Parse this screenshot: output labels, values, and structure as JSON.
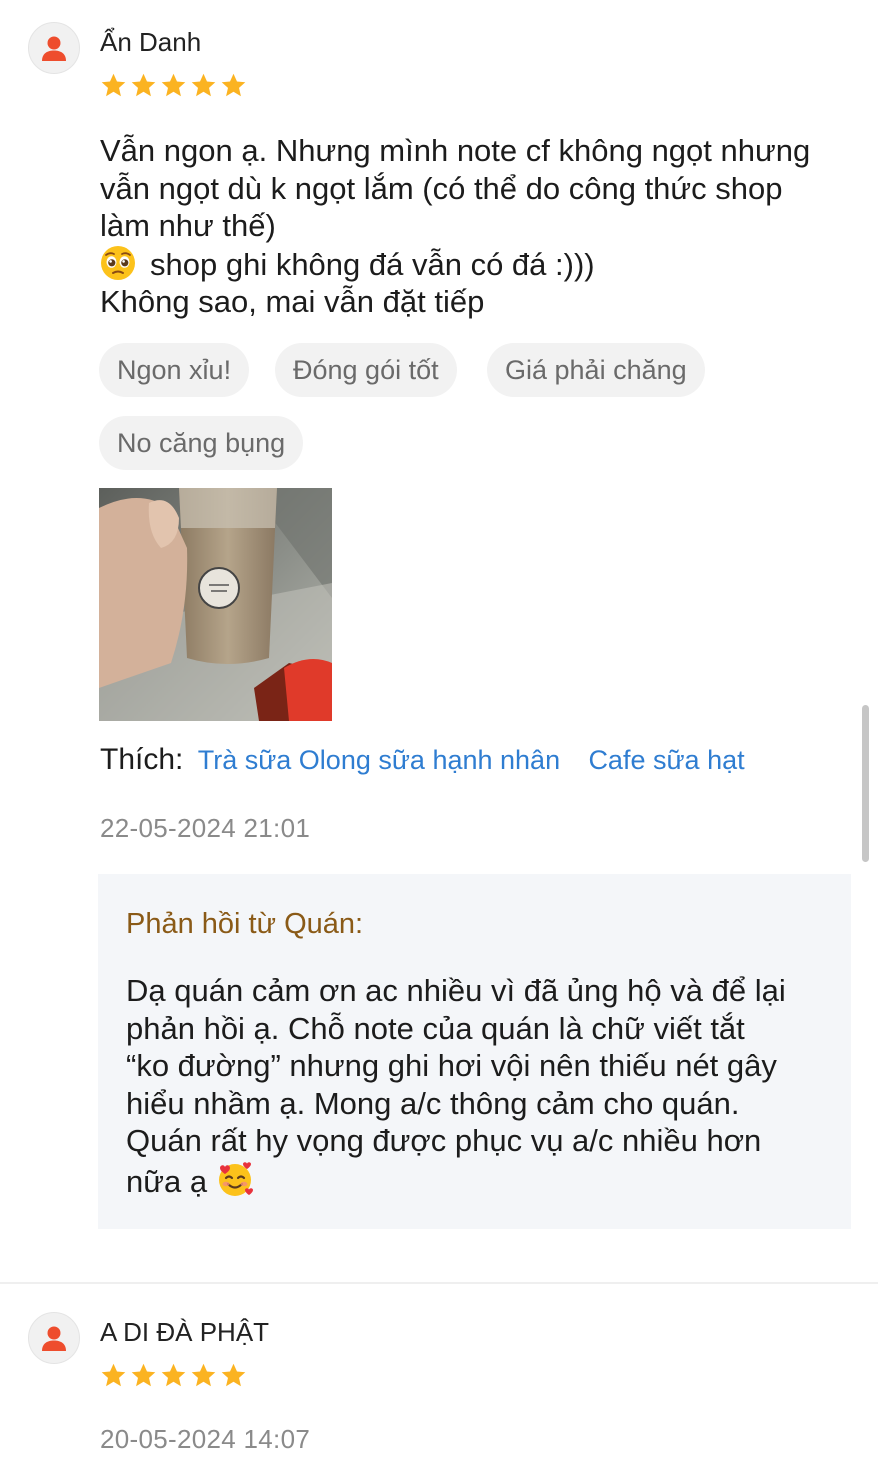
{
  "reviews": [
    {
      "author": "Ẩn Danh",
      "rating": 5,
      "text_lines": [
        "Vẫn ngon ạ. Nhưng mình note cf không ngọt nhưng",
        "vẫn ngọt dù k ngọt lắm (có thể do công thức shop",
        "làm như thế)",
        "shop ghi không đá vẫn có đá :)))",
        "Không sao, mai vẫn đặt tiếp"
      ],
      "tags": [
        "Ngon xỉu!",
        "Đóng gói tốt",
        "Giá phải chăng",
        "No căng bụng"
      ],
      "liked_label": "Thích:",
      "liked_items": [
        "Trà sữa Olong sữa hạnh nhân",
        "Cafe sữa hạt"
      ],
      "date": "22-05-2024 21:01",
      "reply": {
        "title": "Phản hồi từ Quán:",
        "lines": [
          "Dạ quán cảm ơn ac nhiều vì đã ủng hộ và để lại",
          "phản hồi ạ. Chỗ note của quán là chữ viết tắt",
          "“ko đường” nhưng ghi hơi vội nên thiếu nét gây",
          "hiểu nhầm ạ. Mong a/c thông cảm cho quán.",
          "Quán rất hy vọng được phục vụ a/c nhiều hơn",
          "nữa ạ"
        ]
      }
    },
    {
      "author": "A DI ĐÀ PHẬT",
      "rating": 5,
      "date": "20-05-2024 14:07"
    }
  ],
  "colors": {
    "star": "#fbb321",
    "avatar_icon": "#ee4d2d",
    "link": "#2f7dd1",
    "reply_title": "#8a5a17",
    "reply_bg": "#f4f6f9"
  },
  "icons": {
    "avatar": "person-icon",
    "star": "star-icon",
    "emoji_1": "pleading-face-emoji",
    "emoji_2": "smiling-face-with-hearts-emoji"
  }
}
